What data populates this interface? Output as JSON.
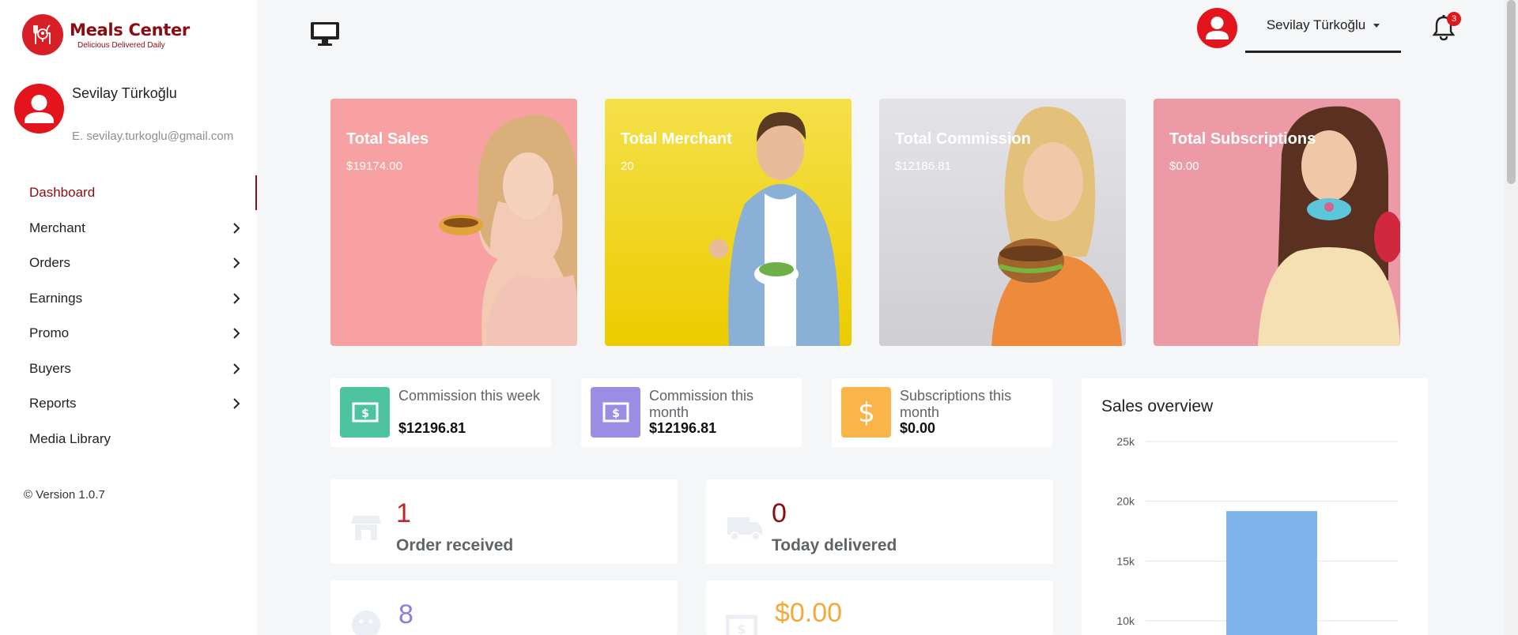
{
  "app": {
    "logo_title": "Meals Center",
    "logo_tagline": "Delicious Delivered Daily"
  },
  "sidebar": {
    "profile_name": "Sevilay Türkoğlu",
    "profile_email": "E. sevilay.turkoglu@gmail.com",
    "items": [
      {
        "label": "Dashboard",
        "active": true,
        "has_submenu": false
      },
      {
        "label": "Merchant",
        "active": false,
        "has_submenu": true
      },
      {
        "label": "Orders",
        "active": false,
        "has_submenu": true
      },
      {
        "label": "Earnings",
        "active": false,
        "has_submenu": true
      },
      {
        "label": "Promo",
        "active": false,
        "has_submenu": true
      },
      {
        "label": "Buyers",
        "active": false,
        "has_submenu": true
      },
      {
        "label": "Reports",
        "active": false,
        "has_submenu": true
      },
      {
        "label": "Media Library",
        "active": false,
        "has_submenu": false
      }
    ],
    "version": "© Version 1.0.7"
  },
  "topbar": {
    "user_name": "Sevilay Türkoğlu",
    "notification_count": "3"
  },
  "stat_cards": [
    {
      "label": "Total Sales",
      "value": "$19174.00",
      "color": "#f8a1a3"
    },
    {
      "label": "Total Merchant",
      "value": "20",
      "color": "#f2d21a"
    },
    {
      "label": "Total Commission",
      "value": "$12186.81",
      "color": "#d9d8dc"
    },
    {
      "label": "Total Subscriptions",
      "value": "$0.00",
      "color": "#ec9ba6"
    }
  ],
  "mini_cards": [
    {
      "label": "Commission this week",
      "value": "$12196.81",
      "color": "#4dc49f",
      "icon": "money-icon"
    },
    {
      "label": "Commission this month",
      "value": "$12196.81",
      "color": "#9c8de4",
      "icon": "money-icon"
    },
    {
      "label": "Subscriptions this month",
      "value": "$0.00",
      "color": "#fab54a",
      "icon": "dollar-icon"
    }
  ],
  "info_cards": [
    {
      "number": "1",
      "label": "Order received",
      "number_color": "#c0252b",
      "icon": "store-icon"
    },
    {
      "number": "0",
      "label": "Today delivered",
      "number_color": "#8b0d11",
      "icon": "truck-icon"
    },
    {
      "number": "8",
      "label": "",
      "number_color": "#8a7de0",
      "icon": "smile-icon"
    },
    {
      "number": "$0.00",
      "label": "",
      "number_color": "#f6a93b",
      "icon": "money-icon"
    }
  ],
  "sales_overview": {
    "title": "Sales overview"
  },
  "chart_data": {
    "type": "bar",
    "title": "Sales overview",
    "categories": [
      ""
    ],
    "values": [
      19174
    ],
    "ylim": [
      0,
      25000
    ],
    "yticks": [
      "25k",
      "20k",
      "15k",
      "10k"
    ],
    "ytick_values": [
      25000,
      20000,
      15000,
      10000
    ],
    "bar_color": "#7db5ea",
    "grid": true
  }
}
